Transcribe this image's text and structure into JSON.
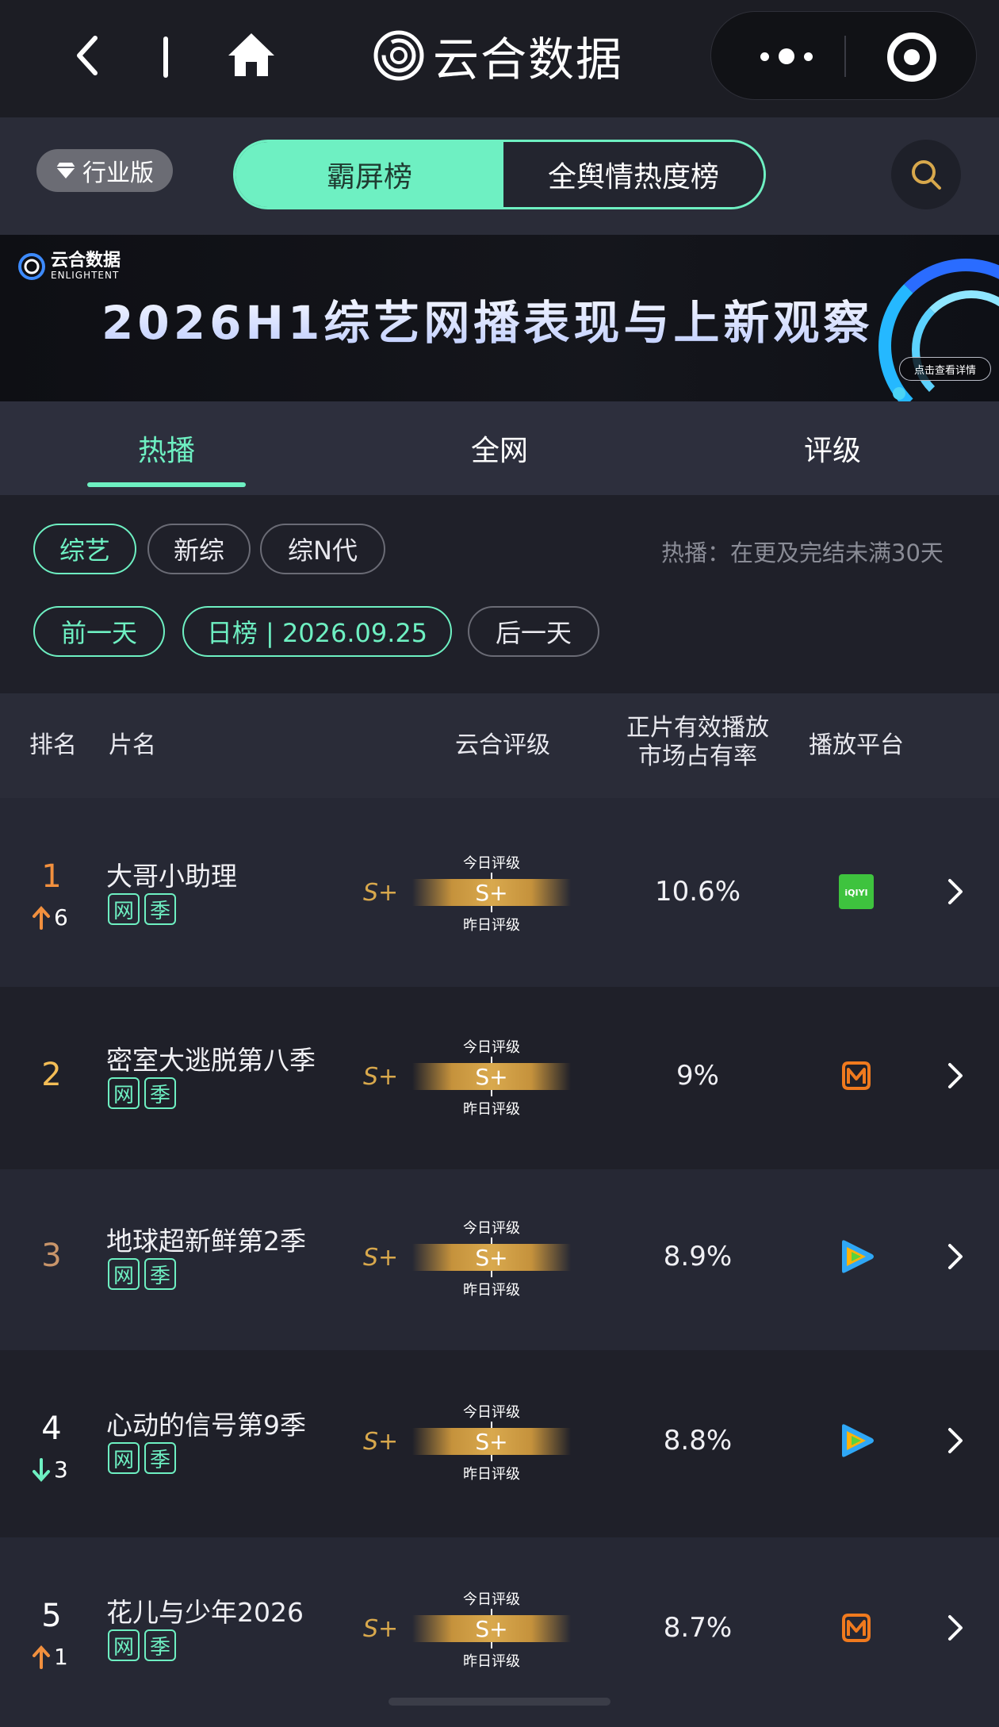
{
  "navbar": {
    "brand": "云合数据"
  },
  "header": {
    "edition": "行业版",
    "switch": [
      "霸屏榜",
      "全舆情热度榜"
    ]
  },
  "banner": {
    "logo_line1": "云合数据",
    "logo_line2": "ENLIGHTENT",
    "title": "2026H1综艺网播表现与上新观察",
    "button": "点击查看详情"
  },
  "tabs": [
    "热播",
    "全网",
    "评级"
  ],
  "filters": {
    "chips": [
      "综艺",
      "新综",
      "综N代"
    ],
    "note": "热播：在更及完结未满30天",
    "prev": "前一天",
    "date": "日榜 | 2026.09.25",
    "next": "后一天"
  },
  "table": {
    "headers": {
      "rank": "排名",
      "title": "片名",
      "rating": "云合评级",
      "share_line1": "正片有效播放",
      "share_line2": "市场占有率",
      "platform": "播放平台"
    },
    "rating_labels": {
      "today": "今日评级",
      "yesterday": "昨日评级"
    },
    "tags": [
      "网",
      "季"
    ],
    "rows": [
      {
        "rank": "1",
        "change": "6",
        "change_dir": "up",
        "title": "大哥小助理",
        "rating_prev": "S+",
        "rating": "S+",
        "share": "10.6%",
        "platform": "iqiyi-icon",
        "platform_text": "iQIYI"
      },
      {
        "rank": "2",
        "change": "",
        "change_dir": "",
        "title": "密室大逃脱第八季",
        "rating_prev": "S+",
        "rating": "S+",
        "share": "9%",
        "platform": "mango-tv-icon"
      },
      {
        "rank": "3",
        "change": "",
        "change_dir": "",
        "title": "地球超新鲜第2季",
        "rating_prev": "S+",
        "rating": "S+",
        "share": "8.9%",
        "platform": "tencent-video-icon"
      },
      {
        "rank": "4",
        "change": "3",
        "change_dir": "down",
        "title": "心动的信号第9季",
        "rating_prev": "S+",
        "rating": "S+",
        "share": "8.8%",
        "platform": "tencent-video-icon"
      },
      {
        "rank": "5",
        "change": "1",
        "change_dir": "up",
        "title": "花儿与少年2026",
        "rating_prev": "S+",
        "rating": "S+",
        "share": "8.7%",
        "platform": "mango-tv-icon"
      }
    ]
  },
  "colors": {
    "accent": "#6ef0c2",
    "gold": "#d8a84c",
    "up": "#f2903e",
    "down": "#6ef0c2"
  }
}
